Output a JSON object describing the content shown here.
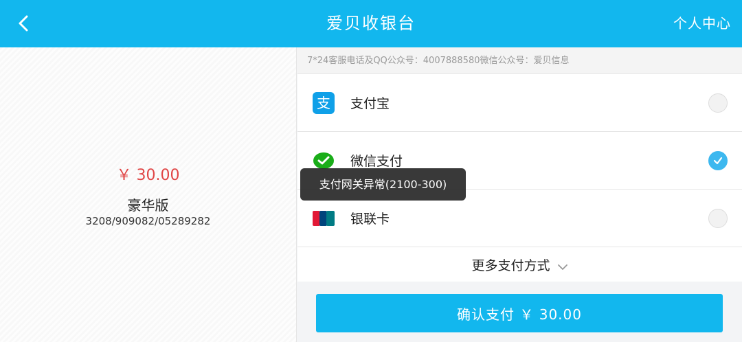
{
  "header": {
    "title": "爱贝收银台",
    "user_center": "个人中心"
  },
  "order": {
    "amount": "￥ 30.00",
    "product": "豪华版",
    "order_no": "3208/909082/05289282"
  },
  "notice": "7*24客服电话及QQ公众号：4007888580微信公众号：爱贝信息",
  "methods": [
    {
      "label": "支付宝",
      "icon": "alipay-icon",
      "selected": false
    },
    {
      "label": "微信支付",
      "icon": "wechat-pay-icon",
      "selected": true
    },
    {
      "label": "银联卡",
      "icon": "unionpay-icon",
      "selected": false
    }
  ],
  "more_methods": "更多支付方式",
  "confirm_label": "确认支付 ￥ 30.00",
  "toast": "支付网关异常(2100-300)",
  "colors": {
    "accent": "#12b7ee",
    "amount": "#e04545",
    "alipay": "#0fa0e8",
    "wechat": "#1aad19"
  }
}
